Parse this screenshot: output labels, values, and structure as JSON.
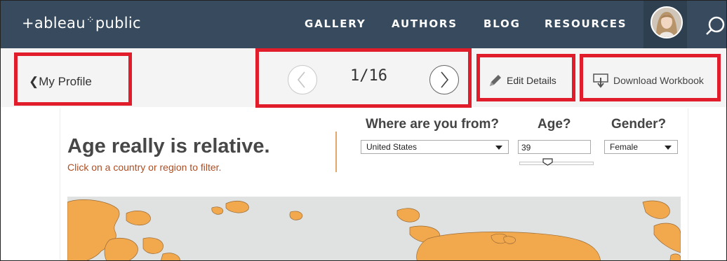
{
  "brand": {
    "logo_text_left": "+ableau",
    "logo_text_right": "public"
  },
  "nav": {
    "items": [
      "GALLERY",
      "AUTHORS",
      "BLOG",
      "RESOURCES"
    ]
  },
  "toolbar": {
    "back_label": "My Profile",
    "pager_text": "1/16",
    "edit_label": "Edit Details",
    "download_label": "Download Workbook"
  },
  "viz": {
    "title": "Age really is relative.",
    "subtitle": "Click on a country or region to filter.",
    "filters": {
      "where_label": "Where are you from?",
      "country_value": "United States",
      "age_label": "Age?",
      "age_value": "39",
      "gender_label": "Gender?",
      "gender_value": "Female"
    }
  },
  "colors": {
    "nav_bg": "#384b5e",
    "highlight": "#e11d2b",
    "map_land": "#f2a94e",
    "map_sea": "#dfe2e0",
    "subtitle": "#b04c20"
  },
  "icons": [
    "logo-icon",
    "avatar",
    "search-icon",
    "chevron-left-icon",
    "prev-arrow-icon",
    "next-arrow-icon",
    "pencil-icon",
    "download-icon",
    "chevron-down-icon",
    "slider-thumb-icon"
  ]
}
